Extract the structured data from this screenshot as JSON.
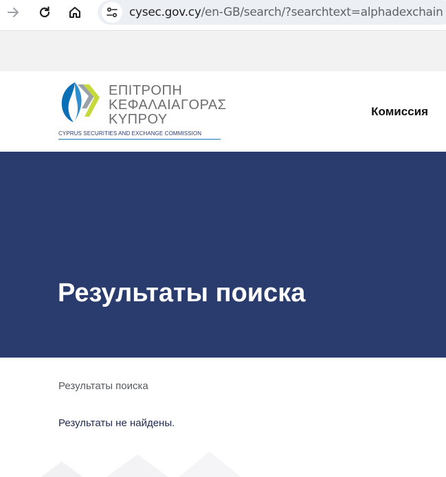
{
  "browser": {
    "url_host": "cysec.gov.cy",
    "url_path": "/en-GB/search/?searchtext=alphadexchain"
  },
  "header": {
    "logo": {
      "line1": "ΕΠΙΤΡΟΠΗ",
      "line2": "ΚΕΦΑΛΑΙΑΓΟΡΑΣ",
      "line3": "ΚΥΠΡΟΥ",
      "subtitle": "CYPRUS SECURITIES AND EXCHANGE COMMISSION"
    },
    "nav_link": "Комиссия"
  },
  "hero": {
    "title": "Результаты поиска"
  },
  "content": {
    "breadcrumb": "Результаты поиска",
    "message": "Результаты не найдены."
  },
  "colors": {
    "hero_bg": "#2a3b6d",
    "logo_blue": "#0a6fb6",
    "logo_green": "#c6d93a"
  }
}
